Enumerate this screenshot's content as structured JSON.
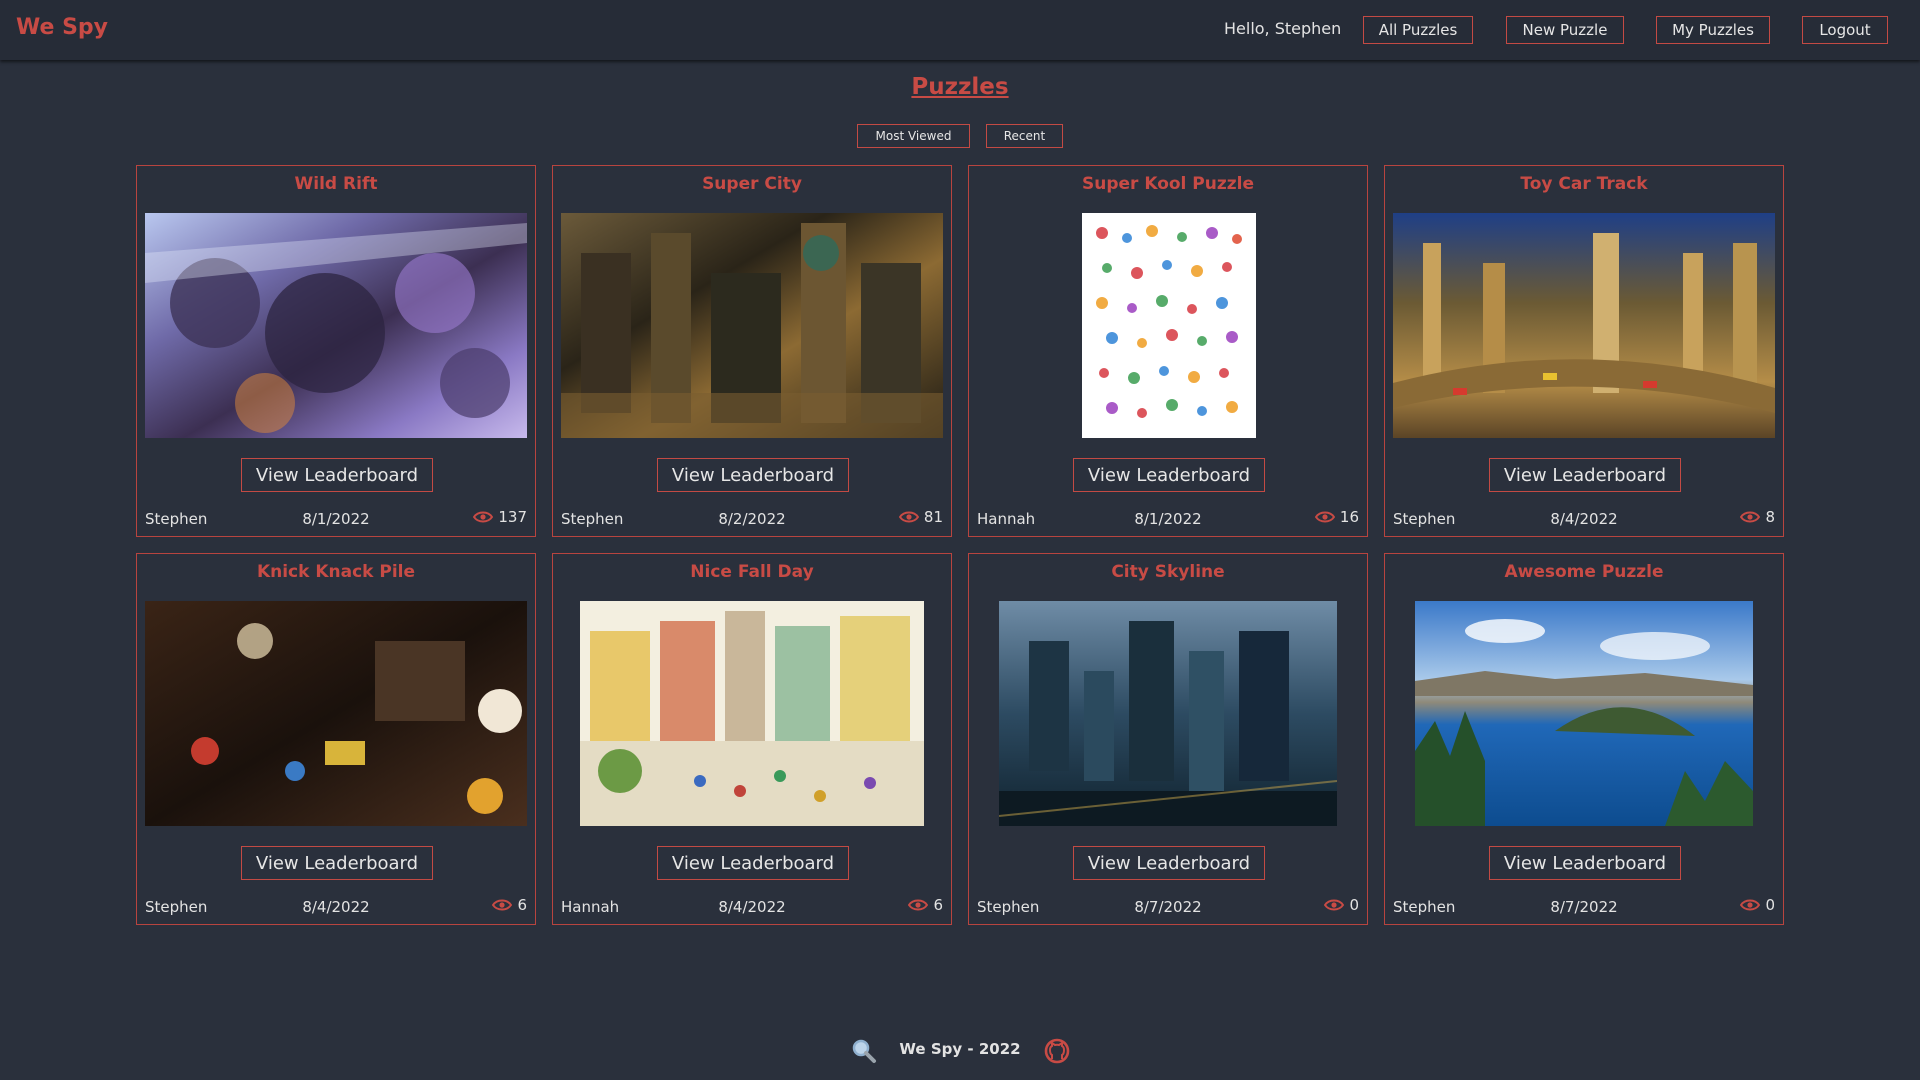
{
  "brand": "We Spy",
  "nav": {
    "greeting": "Hello, Stephen",
    "all_puzzles": "All Puzzles",
    "new_puzzle": "New Puzzle",
    "my_puzzles": "My Puzzles",
    "logout": "Logout"
  },
  "page": {
    "title": "Puzzles",
    "sort_most_viewed": "Most Viewed",
    "sort_recent": "Recent"
  },
  "colors": {
    "accent": "#c84b45",
    "background": "#2a303c",
    "text": "#e6e6e6"
  },
  "leaderboard_label": "View Leaderboard",
  "puzzles": [
    {
      "title": "Wild Rift",
      "author": "Stephen",
      "date": "8/1/2022",
      "views": "137",
      "image": "fantasy-characters-illustration"
    },
    {
      "title": "Super City",
      "author": "Stephen",
      "date": "8/2/2022",
      "views": "81",
      "image": "dense-city-illustration"
    },
    {
      "title": "Super Kool Puzzle",
      "author": "Hannah",
      "date": "8/1/2022",
      "views": "16",
      "image": "colorful-objects-poster"
    },
    {
      "title": "Toy Car Track",
      "author": "Stephen",
      "date": "8/4/2022",
      "views": "8",
      "image": "toy-car-track-scene"
    },
    {
      "title": "Knick Knack Pile",
      "author": "Stephen",
      "date": "8/4/2022",
      "views": "6",
      "image": "toy-pile-photo"
    },
    {
      "title": "Nice Fall Day",
      "author": "Hannah",
      "date": "8/4/2022",
      "views": "6",
      "image": "town-crowd-illustration"
    },
    {
      "title": "City Skyline",
      "author": "Stephen",
      "date": "8/7/2022",
      "views": "0",
      "image": "aerial-city-photo"
    },
    {
      "title": "Awesome Puzzle",
      "author": "Stephen",
      "date": "8/7/2022",
      "views": "0",
      "image": "crater-lake-photo"
    }
  ],
  "footer": {
    "text": "We Spy - 2022",
    "left_icon": "search-icon",
    "right_icon": "github-icon"
  }
}
